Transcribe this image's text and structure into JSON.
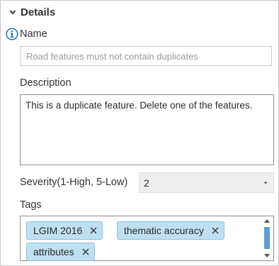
{
  "section": {
    "title": "Details",
    "icon": "chevron-down-icon"
  },
  "name": {
    "label": "Name",
    "info_icon": "info-icon",
    "placeholder": "Road features must not contain duplicates"
  },
  "description": {
    "label": "Description",
    "value": "This is a duplicate feature. Delete one of the features."
  },
  "severity": {
    "label": "Severity(1-High, 5-Low)",
    "value": "2"
  },
  "tags": {
    "label": "Tags",
    "items": [
      {
        "text": "LGIM 2016"
      },
      {
        "text": "thematic accuracy"
      },
      {
        "text": "attributes"
      }
    ]
  },
  "colors": {
    "tag_fill": "#bfe0f3",
    "tag_border": "#8cc1e0",
    "info_icon": "#1a6fb5",
    "scroll_thumb": "#5aa0d8"
  }
}
